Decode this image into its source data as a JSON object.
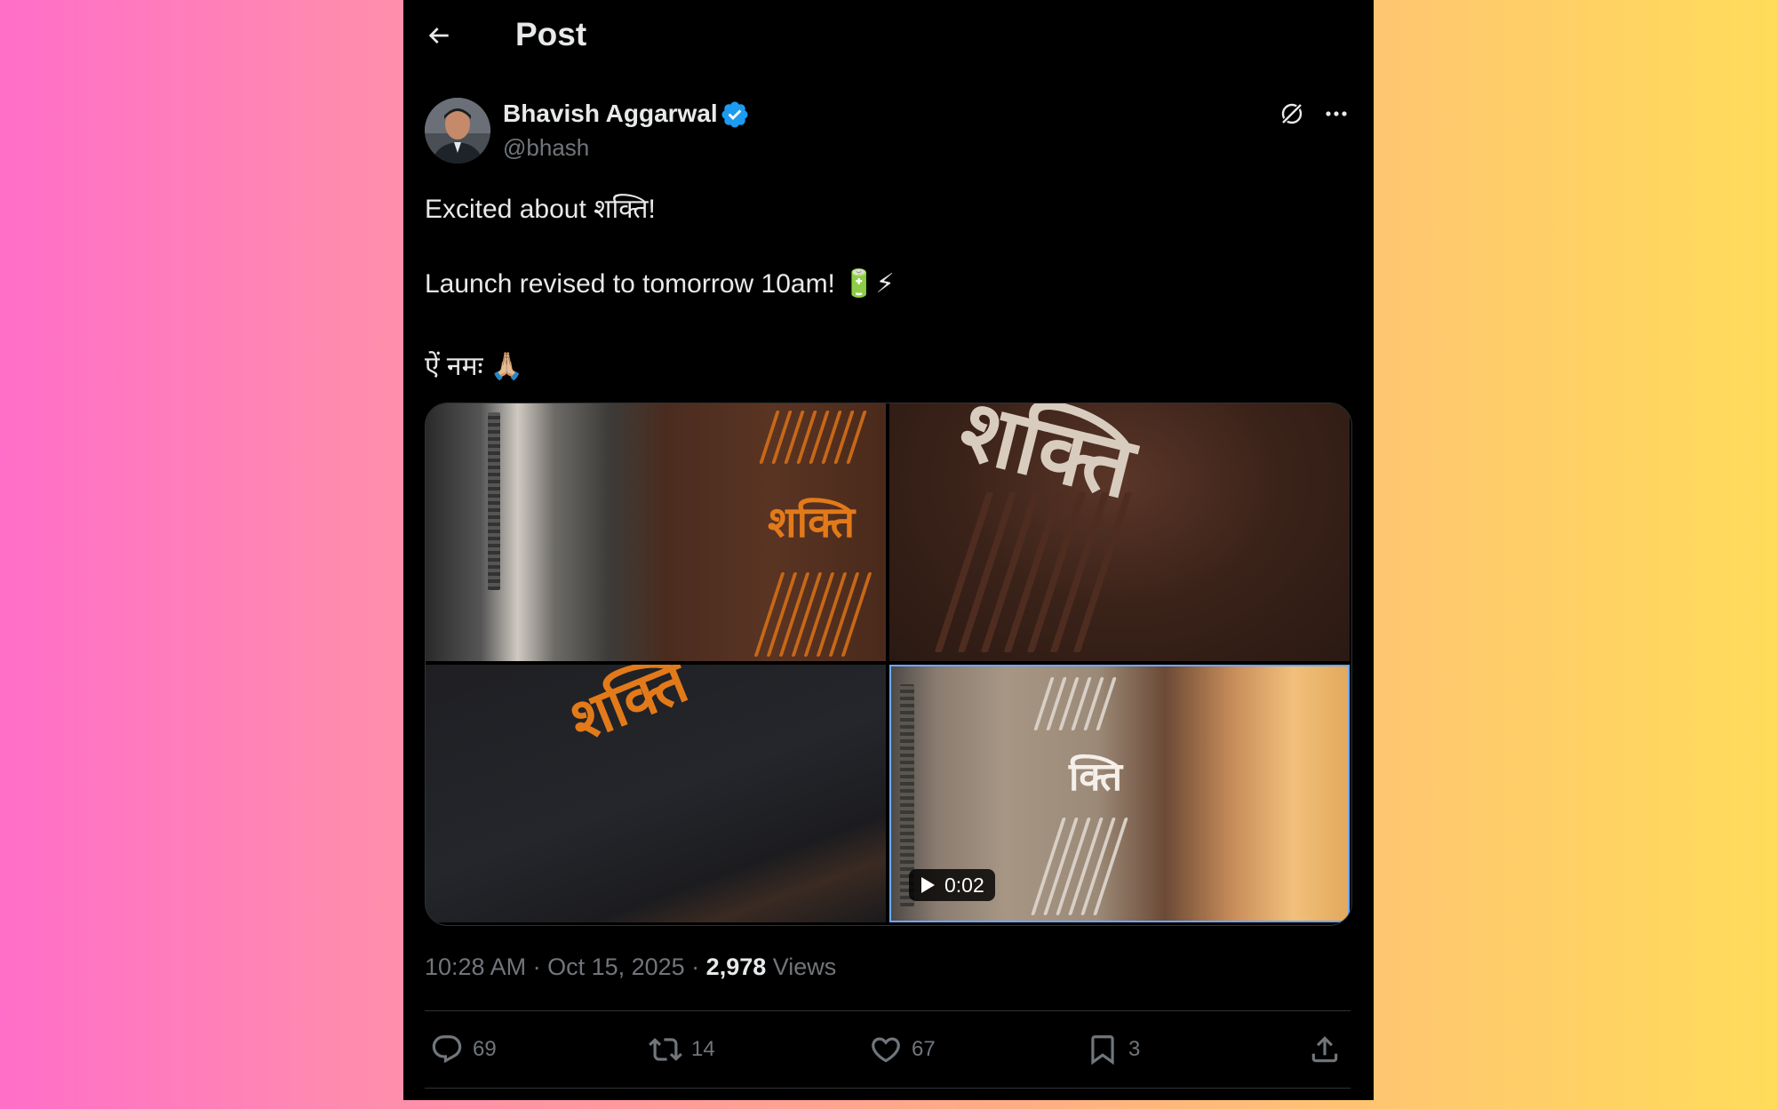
{
  "header": {
    "title": "Post",
    "back_icon": "arrow-left-icon"
  },
  "post": {
    "author_name": "Bhavish Aggarwal",
    "handle": "@bhash",
    "verified": true,
    "text_lines": [
      "Excited about शक्ति!",
      "Launch revised to tomorrow 10am! 🔋⚡",
      "ऐं नमः 🙏🏼"
    ],
    "media": {
      "tiles": [
        {
          "label": "शक्ति"
        },
        {
          "label": "शक्ति"
        },
        {
          "label": "शक्ति"
        },
        {
          "label": "क्ति",
          "duration": "0:02"
        }
      ]
    },
    "timestamp": "10:28 AM · Oct 15, 2025 · ",
    "views_count": "2,978",
    "views_label": " Views"
  },
  "actions": {
    "reply_count": "69",
    "repost_count": "14",
    "like_count": "67",
    "bookmark_count": "3"
  },
  "colors": {
    "background": "#000000",
    "text_primary": "#e7e9ea",
    "text_secondary": "#71767b",
    "verified_blue": "#1d9bf0",
    "divider": "#2f3336",
    "accent_orange": "#e37a1a"
  }
}
